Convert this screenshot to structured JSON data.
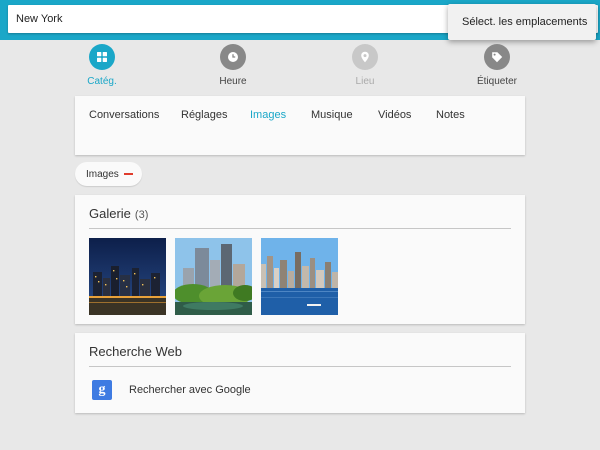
{
  "search": {
    "value": "New York"
  },
  "popup_menu": {
    "label": "Sélect. les emplacements"
  },
  "filter_tabs": [
    {
      "label": "Catég.",
      "icon": "grid-icon",
      "color": "#1aa7c8",
      "state": "active"
    },
    {
      "label": "Heure",
      "icon": "clock-icon",
      "color": "#888888",
      "state": "normal"
    },
    {
      "label": "Lieu",
      "icon": "location-pin-icon",
      "color": "#c8c8c8",
      "state": "disabled"
    },
    {
      "label": "Étiqueter",
      "icon": "tag-icon",
      "color": "#888888",
      "state": "normal"
    }
  ],
  "categories": {
    "items": [
      "Conversations",
      "Réglages",
      "Images",
      "Musique",
      "Vidéos",
      "Notes"
    ],
    "selected": "Images"
  },
  "active_filter_chip": {
    "label": "Images"
  },
  "gallery": {
    "title": "Galerie",
    "count": "(3)",
    "thumbnails": [
      {
        "subject": "city-skyline-at-night"
      },
      {
        "subject": "park-with-skyscrapers"
      },
      {
        "subject": "skyline-over-water"
      }
    ]
  },
  "web_search": {
    "title": "Recherche Web",
    "item_label": "Rechercher avec Google",
    "item_icon": "google-icon"
  },
  "colors": {
    "accent": "#1aa7c8",
    "remove": "#e03c2d",
    "google_blue": "#3e7be2"
  }
}
